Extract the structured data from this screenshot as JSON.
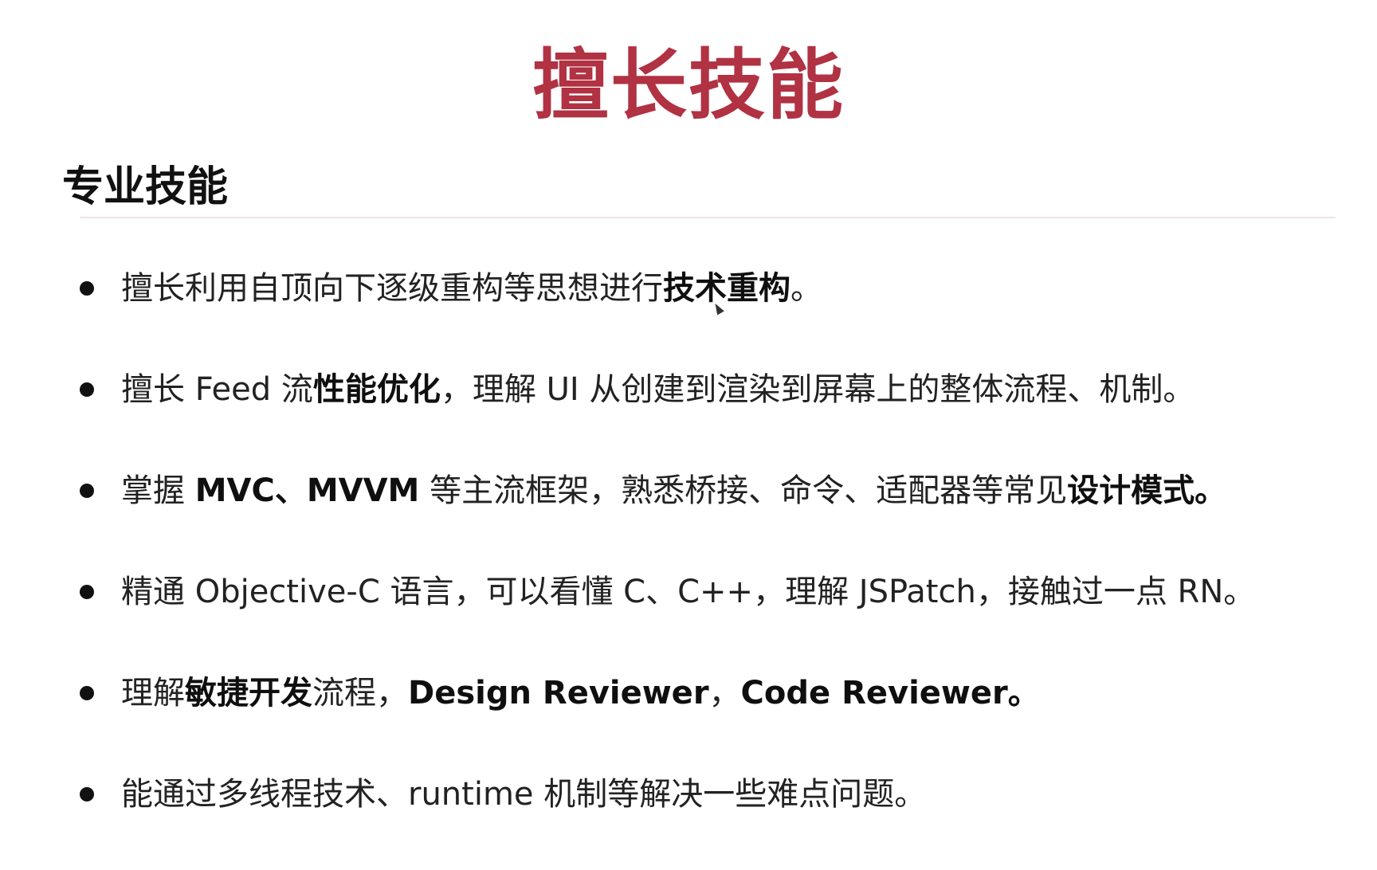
{
  "slide": {
    "title": "擅长技能",
    "section_heading": "专业技能",
    "bullets": [
      {
        "parts": [
          {
            "text": "擅长利用自顶向下逐级重构等思想进行",
            "bold": false
          },
          {
            "text": "技术重构",
            "bold": true
          },
          {
            "text": "。",
            "bold": false
          }
        ]
      },
      {
        "parts": [
          {
            "text": "擅长 Feed 流",
            "bold": false
          },
          {
            "text": "性能优化",
            "bold": true
          },
          {
            "text": "，理解 UI 从创建到渲染到屏幕上的整体流程、机制。",
            "bold": false
          }
        ]
      },
      {
        "parts": [
          {
            "text": "掌握 ",
            "bold": false
          },
          {
            "text": "MVC、MVVM",
            "bold": true
          },
          {
            "text": " 等主流框架，熟悉桥接、命令、适配器等常见",
            "bold": false
          },
          {
            "text": "设计模式。",
            "bold": true
          }
        ]
      },
      {
        "parts": [
          {
            "text": "精通 Objective-C 语言，可以看懂 C、C++，理解 JSPatch，接触过一点 RN。",
            "bold": false
          }
        ]
      },
      {
        "parts": [
          {
            "text": "理解",
            "bold": false
          },
          {
            "text": "敏捷开发",
            "bold": true
          },
          {
            "text": "流程，",
            "bold": false
          },
          {
            "text": "Design Reviewer",
            "bold": true
          },
          {
            "text": "，",
            "bold": false
          },
          {
            "text": "Code Reviewer。",
            "bold": true
          }
        ]
      },
      {
        "parts": [
          {
            "text": "能通过多线程技术、runtime 机制等解决一些难点问题。",
            "bold": false
          }
        ]
      }
    ]
  },
  "colors": {
    "title": "#b03243",
    "text": "#222222",
    "divider": "#f0e3e5"
  }
}
